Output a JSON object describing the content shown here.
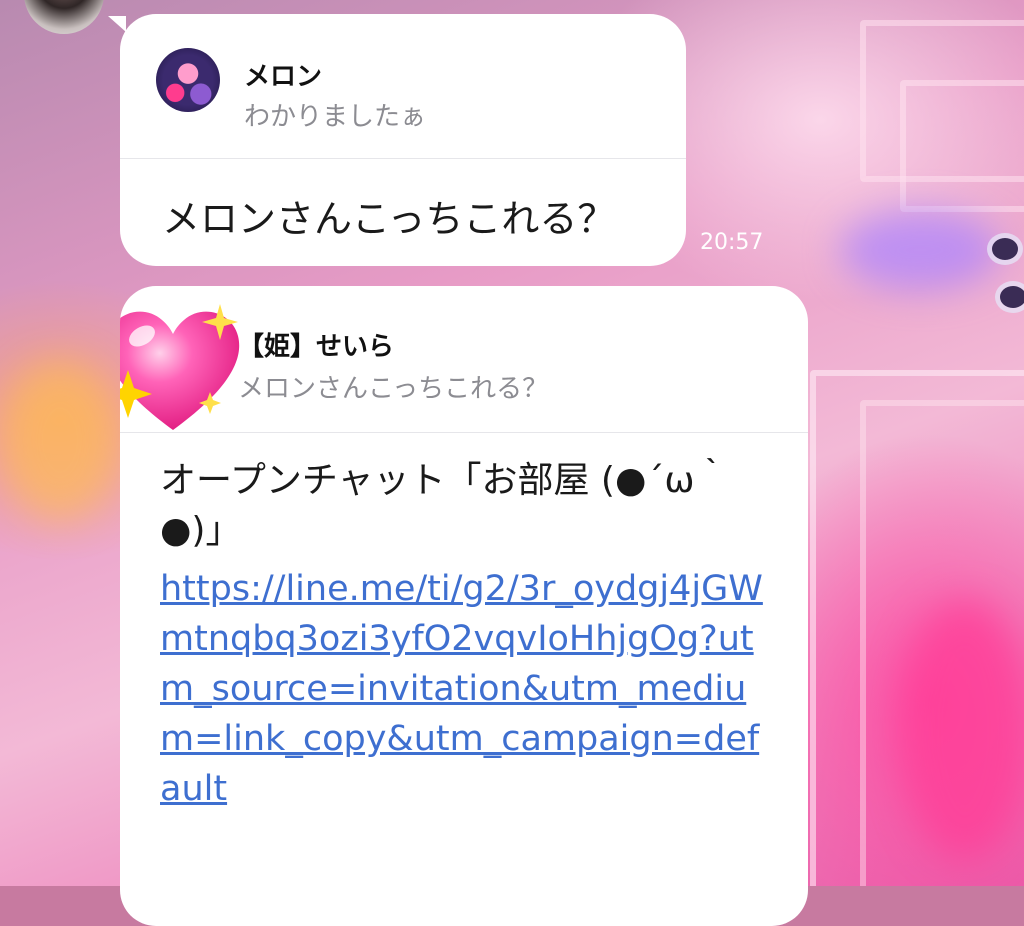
{
  "colors": {
    "bubble_bg": "#ffffff",
    "link": "#3e6fd0",
    "quote_text": "#8c8c92",
    "time_text": "#ffffff"
  },
  "messages": [
    {
      "reply_to": {
        "sender": "メロン",
        "text": "わかりましたぁ",
        "avatar_icon": "anime-avatar"
      },
      "text": "メロンさんこっちこれる？",
      "time": "20:57"
    },
    {
      "reply_to": {
        "sender": "【姫】せいら",
        "text": "メロンさんこっちこれる？",
        "avatar_icon": "sparkling-heart-icon"
      },
      "text": "オープンチャット「お部屋 (●´ω｀●)」",
      "link": "https://line.me/ti/g2/3r_oydgj4jGWmtnqbq3ozi3yfO2vqvIoHhjgOg?utm_source=invitation&utm_medium=link_copy&utm_campaign=default"
    }
  ]
}
